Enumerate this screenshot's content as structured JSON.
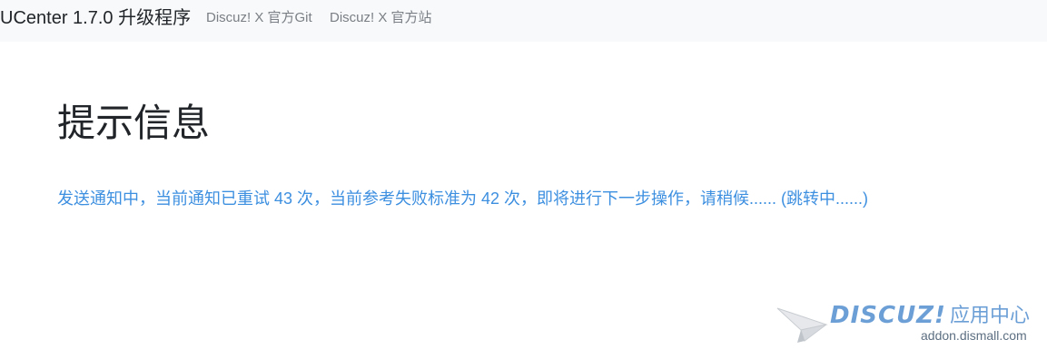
{
  "navbar": {
    "brand": "UCenter 1.7.0 升级程序",
    "links": [
      {
        "label": "Discuz! X 官方Git"
      },
      {
        "label": "Discuz! X 官方站"
      }
    ]
  },
  "main": {
    "title": "提示信息",
    "message": "发送通知中，当前通知已重试 43 次，当前参考失败标准为 42 次，即将进行下一步操作，请稍候...... (跳转中......)"
  },
  "watermark": {
    "logo_text": "DISCUZ!",
    "suffix": "应用中心",
    "url": "addon.dismall.com"
  },
  "colors": {
    "navbar_bg": "#f8f9fa",
    "link_blue": "#3d8fe0",
    "watermark_blue": "#6c9fd6"
  },
  "icons": {
    "watermark_plane": "paper-plane-icon"
  }
}
